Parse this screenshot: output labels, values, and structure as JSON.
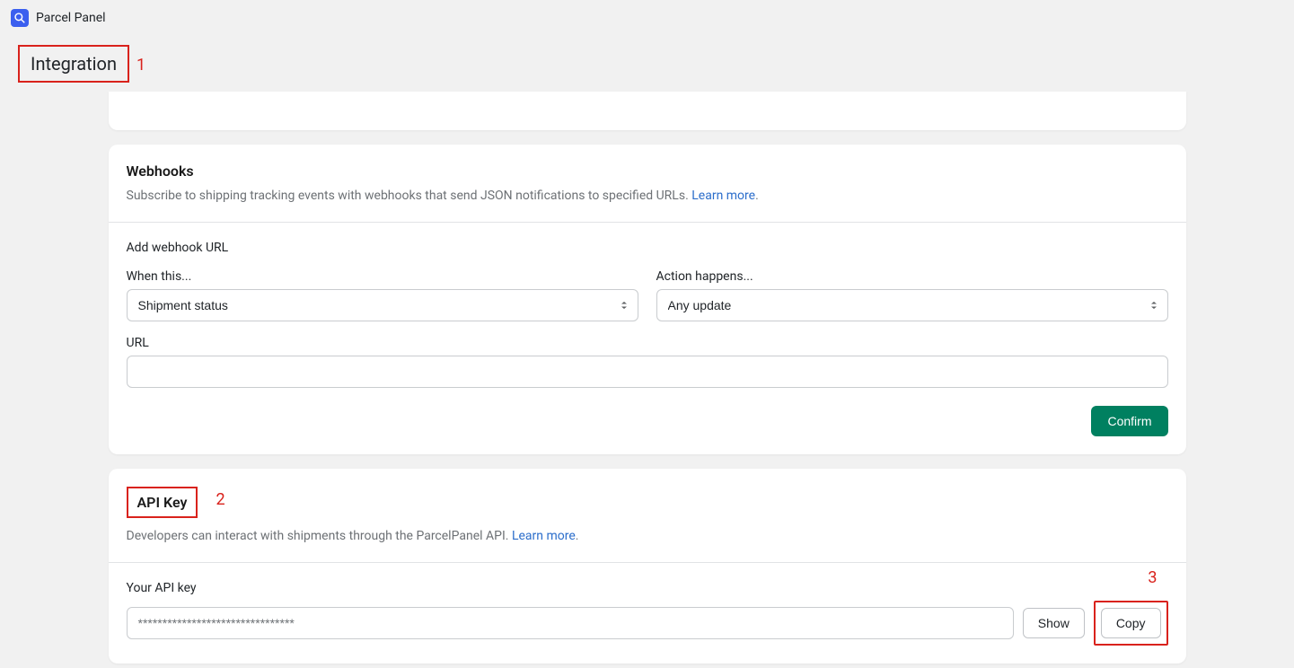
{
  "app": {
    "title": "Parcel Panel"
  },
  "page": {
    "title": "Integration"
  },
  "annotations": {
    "one": "1",
    "two": "2",
    "three": "3"
  },
  "webhooks": {
    "title": "Webhooks",
    "desc": "Subscribe to shipping tracking events with webhooks that send JSON notifications to specified URLs. ",
    "learn_more": "Learn more",
    "dot": ".",
    "add_url_heading": "Add webhook URL",
    "when_this_label": "When this...",
    "when_this_value": "Shipment status",
    "action_label": "Action happens...",
    "action_value": "Any update",
    "url_label": "URL",
    "url_value": "",
    "confirm_label": "Confirm"
  },
  "apikey": {
    "title": "API Key",
    "desc": "Developers can interact with shipments through the ParcelPanel API. ",
    "learn_more": "Learn more",
    "dot": ".",
    "your_key_label": "Your API key",
    "key_value": "********************************",
    "show_label": "Show",
    "copy_label": "Copy"
  }
}
